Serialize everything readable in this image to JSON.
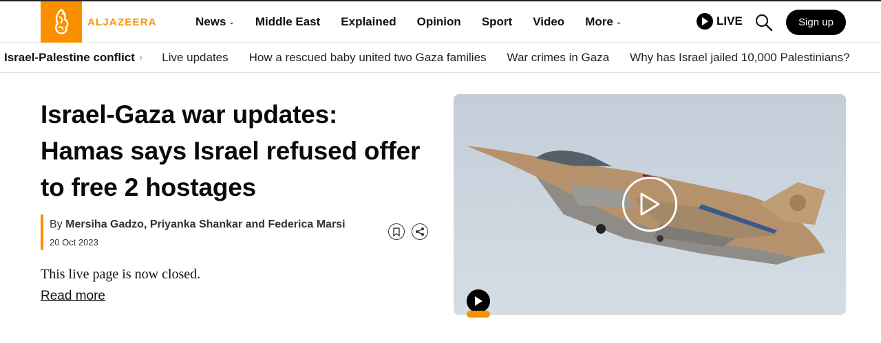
{
  "brand": {
    "name": "ALJAZEERA",
    "color": "#fa9000"
  },
  "nav": {
    "items": [
      {
        "label": "News",
        "dropdown": true
      },
      {
        "label": "Middle East",
        "dropdown": false
      },
      {
        "label": "Explained",
        "dropdown": false
      },
      {
        "label": "Opinion",
        "dropdown": false
      },
      {
        "label": "Sport",
        "dropdown": false
      },
      {
        "label": "Video",
        "dropdown": false
      },
      {
        "label": "More",
        "dropdown": true
      }
    ],
    "live_label": "LIVE",
    "signup_label": "Sign up",
    "icons": [
      "play-icon",
      "search-icon"
    ]
  },
  "subnav": {
    "topic": "Israel-Palestine conflict",
    "links": [
      "Live updates",
      "How a rescued baby united two Gaza families",
      "War crimes in Gaza",
      "Why has Israel jailed 10,000 Palestinians?"
    ]
  },
  "article": {
    "headline": "Israel-Gaza war updates: Hamas says Israel refused offer to free 2 hostages",
    "byline_prefix": "By",
    "authors": "Mersiha Gadzo, Priyanka Shankar and Federica Marsi",
    "date": "20 Oct 2023",
    "status_text": "This live page is now closed.",
    "read_more": "Read more",
    "action_icons": [
      "bookmark-icon",
      "share-icon"
    ]
  },
  "media": {
    "accent_color": "#fa9000",
    "icons": [
      "play-icon",
      "play-icon"
    ]
  }
}
